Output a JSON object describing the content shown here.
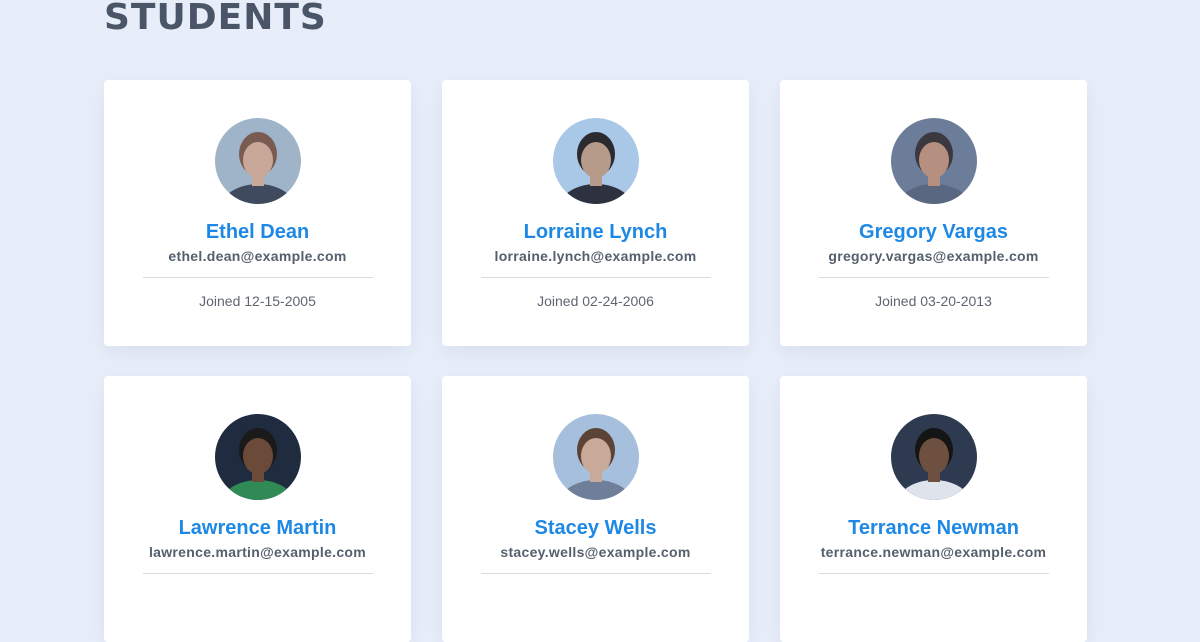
{
  "header": {
    "title": "STUDENTS"
  },
  "students": [
    {
      "name": "Ethel Dean",
      "email": "ethel.dean@example.com",
      "joined": "Joined 12-15-2005",
      "avatar_bg": "#9fb4c9",
      "skin": "#c9a89a",
      "hair": "#7a5b52",
      "shirt": "#3f4a5f"
    },
    {
      "name": "Lorraine Lynch",
      "email": "lorraine.lynch@example.com",
      "joined": "Joined 02-24-2006",
      "avatar_bg": "#a9c7e6",
      "skin": "#b69a8a",
      "hair": "#2a2a2f",
      "shirt": "#2d3140"
    },
    {
      "name": "Gregory Vargas",
      "email": "gregory.vargas@example.com",
      "joined": "Joined 03-20-2013",
      "avatar_bg": "#6b7d99",
      "skin": "#b58f80",
      "hair": "#3c3840",
      "shirt": "#5a6780"
    },
    {
      "name": "Lawrence Martin",
      "email": "lawrence.martin@example.com",
      "joined": "",
      "avatar_bg": "#1f2b3e",
      "skin": "#6b4a3a",
      "hair": "#1a1a1a",
      "shirt": "#2f8a55"
    },
    {
      "name": "Stacey Wells",
      "email": "stacey.wells@example.com",
      "joined": "",
      "avatar_bg": "#a5bfdc",
      "skin": "#c9a99a",
      "hair": "#5b4436",
      "shirt": "#6f7f9a"
    },
    {
      "name": "Terrance Newman",
      "email": "terrance.newman@example.com",
      "joined": "",
      "avatar_bg": "#2e3a4f",
      "skin": "#6e5040",
      "hair": "#151515",
      "shirt": "#dfe4ec"
    }
  ]
}
